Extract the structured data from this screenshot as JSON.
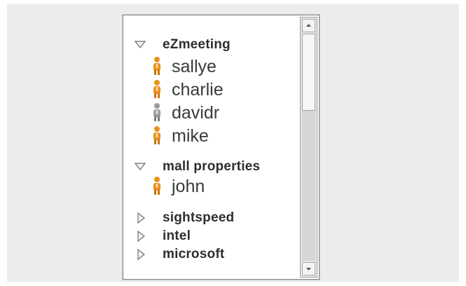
{
  "window": {
    "accent_colors": {
      "online_icon": "#e8901c",
      "offline_icon": "#9a9a9a",
      "label_text": "#2e2e2e"
    }
  },
  "contact_tree": {
    "groups": [
      {
        "name": "eZmeeting",
        "expanded": true,
        "icon": "expanded-triangle-icon",
        "contacts": [
          {
            "name": "sallye",
            "status": "online",
            "icon": "person-icon"
          },
          {
            "name": "charlie",
            "status": "online",
            "icon": "person-icon"
          },
          {
            "name": "davidr",
            "status": "offline",
            "icon": "person-icon"
          },
          {
            "name": "mike",
            "status": "online",
            "icon": "person-icon"
          }
        ]
      },
      {
        "name": "mall properties",
        "expanded": true,
        "icon": "expanded-triangle-icon",
        "contacts": [
          {
            "name": "john",
            "status": "online",
            "icon": "person-icon"
          }
        ]
      },
      {
        "name": "sightspeed",
        "expanded": false,
        "icon": "collapsed-triangle-icon"
      },
      {
        "name": "intel",
        "expanded": false,
        "icon": "collapsed-triangle-icon"
      },
      {
        "name": "microsoft",
        "expanded": false,
        "icon": "collapsed-triangle-icon"
      }
    ]
  },
  "scrollbar": {
    "up_icon": "scroll-up-arrow-icon",
    "down_icon": "scroll-down-arrow-icon",
    "position": 0.0
  }
}
